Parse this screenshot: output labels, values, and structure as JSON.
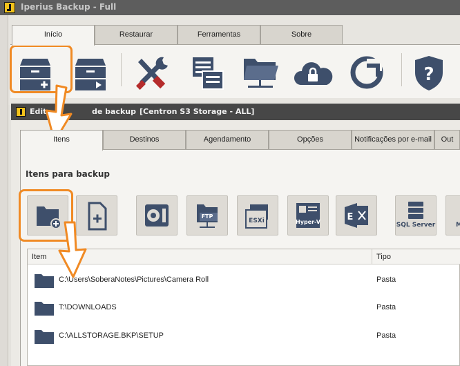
{
  "app": {
    "title": "Iperius Backup - Full"
  },
  "main_tabs": [
    {
      "label": "Início",
      "active": true
    },
    {
      "label": "Restaurar",
      "active": false
    },
    {
      "label": "Ferramentas",
      "active": false
    },
    {
      "label": "Sobre",
      "active": false
    }
  ],
  "toolbar_icons": [
    "new-backup-icon",
    "run-backup-icon",
    "tools-icon",
    "log-list-icon",
    "network-folder-icon",
    "cloud-lock-icon",
    "restore-icon",
    "help-icon"
  ],
  "job_window": {
    "title_part1": "Edita",
    "title_part2": "de backup",
    "title_part3": "[Centron S3 Storage - ALL]"
  },
  "inner_tabs": [
    {
      "label": "Itens",
      "active": true
    },
    {
      "label": "Destinos",
      "active": false
    },
    {
      "label": "Agendamento",
      "active": false
    },
    {
      "label": "Opções",
      "active": false
    },
    {
      "label": "Notificações por e-mail",
      "active": false
    },
    {
      "label": "Out",
      "active": false
    }
  ],
  "section": {
    "title": "Itens para backup"
  },
  "item_buttons": [
    {
      "icon": "add-folder-icon",
      "label": ""
    },
    {
      "icon": "add-file-icon",
      "label": ""
    },
    {
      "icon": "disk-image-icon",
      "label": ""
    },
    {
      "icon": "ftp-icon",
      "label": "FTP"
    },
    {
      "icon": "esxi-icon",
      "label": "ESXi"
    },
    {
      "icon": "hyper-v-icon",
      "label": "Hyper-V"
    },
    {
      "icon": "exchange-icon",
      "label": ""
    },
    {
      "icon": "sql-server-icon",
      "label": "SQL Server"
    },
    {
      "icon": "mysql-icon",
      "label": "M"
    }
  ],
  "list": {
    "columns": [
      "Item",
      "Tipo"
    ],
    "rows": [
      {
        "path": "C:\\Users\\SoberaNotes\\Pictures\\Camera Roll",
        "type": "Pasta"
      },
      {
        "path": "T:\\DOWNLOADS",
        "type": "Pasta"
      },
      {
        "path": "C:\\ALLSTORAGE.BKP\\SETUP",
        "type": "Pasta"
      }
    ]
  },
  "colors": {
    "accent": "#f08a24",
    "icon": "#3e4f6b",
    "titlebar": "#5d5d5d"
  }
}
